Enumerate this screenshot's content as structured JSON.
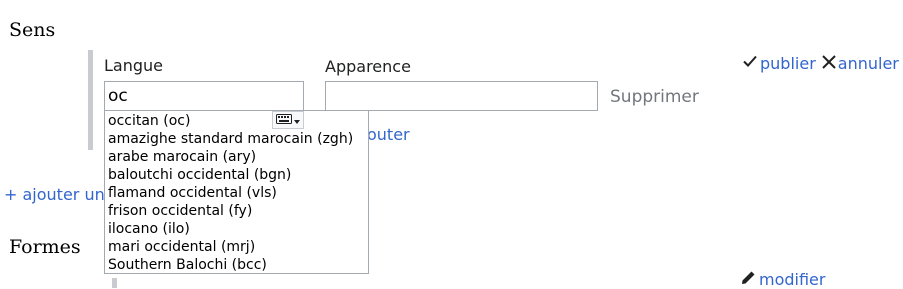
{
  "sense_section": {
    "heading": "Sens",
    "add_sense_label": "+ ajouter un",
    "publish_label": "publier",
    "cancel_label": "annuler"
  },
  "gloss_editor": {
    "language_label": "Langue",
    "language_input_value": "oc",
    "appearance_label": "Apparence",
    "appearance_input_value": "",
    "remove_label": "Supprimer",
    "add_gloss_label": "outer"
  },
  "language_suggestions": [
    {
      "label": "occitan (oc)"
    },
    {
      "label": "amazighe standard marocain (zgh)"
    },
    {
      "label": "arabe marocain (ary)"
    },
    {
      "label": "baloutchi occidental (bgn)"
    },
    {
      "label": "flamand occidental (vls)"
    },
    {
      "label": "frison occidental (fy)"
    },
    {
      "label": "ilocano (ilo)"
    },
    {
      "label": "mari occidental (mrj)"
    },
    {
      "label": "Southern Balochi (bcc)"
    }
  ],
  "forms_section": {
    "heading": "Formes",
    "edit_label": "modifier"
  },
  "colors": {
    "link": "#3366cc",
    "muted": "#72777d",
    "border": "#a2a9b1"
  },
  "icons": [
    "check-icon",
    "close-icon",
    "keyboard-icon",
    "pencil-icon"
  ]
}
